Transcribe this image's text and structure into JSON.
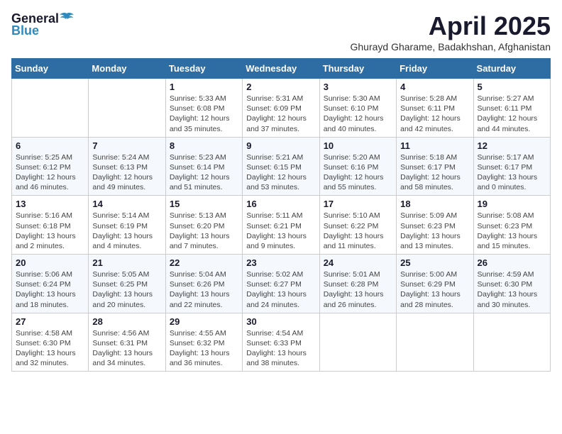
{
  "header": {
    "logo_general": "General",
    "logo_blue": "Blue",
    "month": "April 2025",
    "location": "Ghurayd Gharame, Badakhshan, Afghanistan"
  },
  "weekdays": [
    "Sunday",
    "Monday",
    "Tuesday",
    "Wednesday",
    "Thursday",
    "Friday",
    "Saturday"
  ],
  "weeks": [
    [
      {
        "day": "",
        "info": ""
      },
      {
        "day": "",
        "info": ""
      },
      {
        "day": "1",
        "info": "Sunrise: 5:33 AM\nSunset: 6:08 PM\nDaylight: 12 hours and 35 minutes."
      },
      {
        "day": "2",
        "info": "Sunrise: 5:31 AM\nSunset: 6:09 PM\nDaylight: 12 hours and 37 minutes."
      },
      {
        "day": "3",
        "info": "Sunrise: 5:30 AM\nSunset: 6:10 PM\nDaylight: 12 hours and 40 minutes."
      },
      {
        "day": "4",
        "info": "Sunrise: 5:28 AM\nSunset: 6:11 PM\nDaylight: 12 hours and 42 minutes."
      },
      {
        "day": "5",
        "info": "Sunrise: 5:27 AM\nSunset: 6:11 PM\nDaylight: 12 hours and 44 minutes."
      }
    ],
    [
      {
        "day": "6",
        "info": "Sunrise: 5:25 AM\nSunset: 6:12 PM\nDaylight: 12 hours and 46 minutes."
      },
      {
        "day": "7",
        "info": "Sunrise: 5:24 AM\nSunset: 6:13 PM\nDaylight: 12 hours and 49 minutes."
      },
      {
        "day": "8",
        "info": "Sunrise: 5:23 AM\nSunset: 6:14 PM\nDaylight: 12 hours and 51 minutes."
      },
      {
        "day": "9",
        "info": "Sunrise: 5:21 AM\nSunset: 6:15 PM\nDaylight: 12 hours and 53 minutes."
      },
      {
        "day": "10",
        "info": "Sunrise: 5:20 AM\nSunset: 6:16 PM\nDaylight: 12 hours and 55 minutes."
      },
      {
        "day": "11",
        "info": "Sunrise: 5:18 AM\nSunset: 6:17 PM\nDaylight: 12 hours and 58 minutes."
      },
      {
        "day": "12",
        "info": "Sunrise: 5:17 AM\nSunset: 6:17 PM\nDaylight: 13 hours and 0 minutes."
      }
    ],
    [
      {
        "day": "13",
        "info": "Sunrise: 5:16 AM\nSunset: 6:18 PM\nDaylight: 13 hours and 2 minutes."
      },
      {
        "day": "14",
        "info": "Sunrise: 5:14 AM\nSunset: 6:19 PM\nDaylight: 13 hours and 4 minutes."
      },
      {
        "day": "15",
        "info": "Sunrise: 5:13 AM\nSunset: 6:20 PM\nDaylight: 13 hours and 7 minutes."
      },
      {
        "day": "16",
        "info": "Sunrise: 5:11 AM\nSunset: 6:21 PM\nDaylight: 13 hours and 9 minutes."
      },
      {
        "day": "17",
        "info": "Sunrise: 5:10 AM\nSunset: 6:22 PM\nDaylight: 13 hours and 11 minutes."
      },
      {
        "day": "18",
        "info": "Sunrise: 5:09 AM\nSunset: 6:23 PM\nDaylight: 13 hours and 13 minutes."
      },
      {
        "day": "19",
        "info": "Sunrise: 5:08 AM\nSunset: 6:23 PM\nDaylight: 13 hours and 15 minutes."
      }
    ],
    [
      {
        "day": "20",
        "info": "Sunrise: 5:06 AM\nSunset: 6:24 PM\nDaylight: 13 hours and 18 minutes."
      },
      {
        "day": "21",
        "info": "Sunrise: 5:05 AM\nSunset: 6:25 PM\nDaylight: 13 hours and 20 minutes."
      },
      {
        "day": "22",
        "info": "Sunrise: 5:04 AM\nSunset: 6:26 PM\nDaylight: 13 hours and 22 minutes."
      },
      {
        "day": "23",
        "info": "Sunrise: 5:02 AM\nSunset: 6:27 PM\nDaylight: 13 hours and 24 minutes."
      },
      {
        "day": "24",
        "info": "Sunrise: 5:01 AM\nSunset: 6:28 PM\nDaylight: 13 hours and 26 minutes."
      },
      {
        "day": "25",
        "info": "Sunrise: 5:00 AM\nSunset: 6:29 PM\nDaylight: 13 hours and 28 minutes."
      },
      {
        "day": "26",
        "info": "Sunrise: 4:59 AM\nSunset: 6:30 PM\nDaylight: 13 hours and 30 minutes."
      }
    ],
    [
      {
        "day": "27",
        "info": "Sunrise: 4:58 AM\nSunset: 6:30 PM\nDaylight: 13 hours and 32 minutes."
      },
      {
        "day": "28",
        "info": "Sunrise: 4:56 AM\nSunset: 6:31 PM\nDaylight: 13 hours and 34 minutes."
      },
      {
        "day": "29",
        "info": "Sunrise: 4:55 AM\nSunset: 6:32 PM\nDaylight: 13 hours and 36 minutes."
      },
      {
        "day": "30",
        "info": "Sunrise: 4:54 AM\nSunset: 6:33 PM\nDaylight: 13 hours and 38 minutes."
      },
      {
        "day": "",
        "info": ""
      },
      {
        "day": "",
        "info": ""
      },
      {
        "day": "",
        "info": ""
      }
    ]
  ]
}
